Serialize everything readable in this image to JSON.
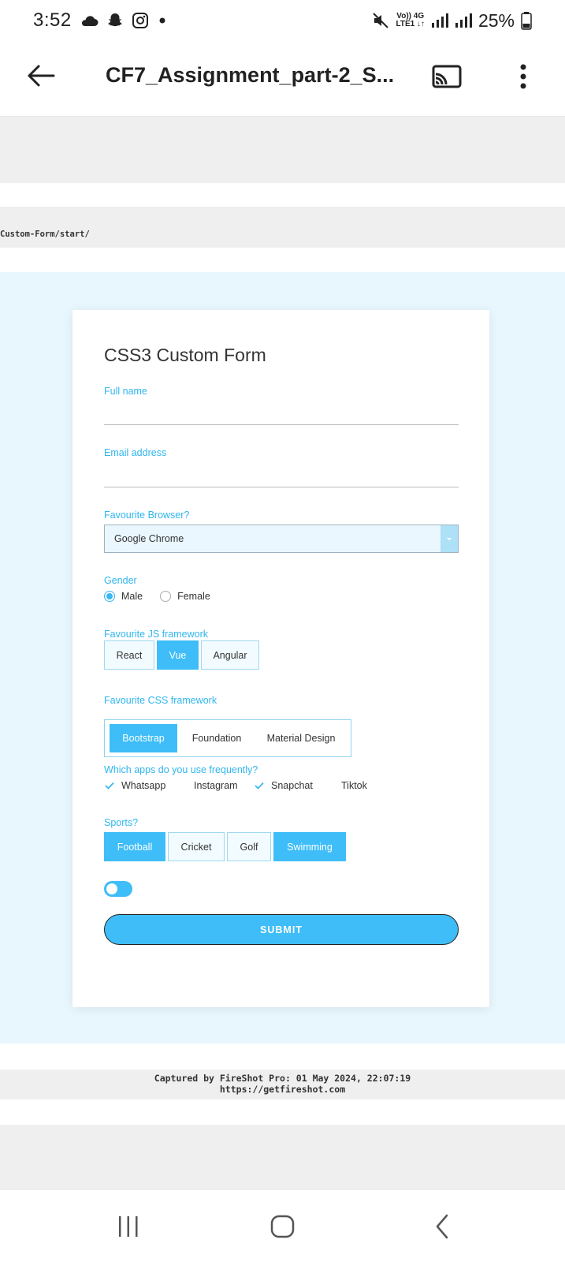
{
  "status_bar": {
    "time": "3:52",
    "net_top": "Vo)) 4G",
    "net_bottom": "LTE1 ↓↑",
    "battery": "25%",
    "icons": [
      "cloud-icon",
      "snapchat-icon",
      "instagram-icon",
      "dot-icon",
      "mute-icon",
      "signal-icon",
      "signal-icon",
      "battery-icon"
    ]
  },
  "app_bar": {
    "title": "CF7_Assignment_part-2_S...",
    "icons": [
      "back-arrow-icon",
      "cast-icon",
      "more-vert-icon"
    ]
  },
  "document": {
    "url_fragment": "Custom-Form/start/",
    "form": {
      "title": "CSS3 Custom Form",
      "full_name_label": "Full name",
      "full_name_value": "",
      "email_label": "Email address",
      "email_value": "",
      "browser_label": "Favourite Browser?",
      "browser_value": "Google Chrome",
      "gender_label": "Gender",
      "gender_options": [
        {
          "label": "Male",
          "selected": true
        },
        {
          "label": "Female",
          "selected": false
        }
      ],
      "js_label": "Favourite JS framework",
      "js_options": [
        {
          "label": "React",
          "selected": false
        },
        {
          "label": "Vue",
          "selected": true
        },
        {
          "label": "Angular",
          "selected": false
        }
      ],
      "css_label": "Favourite CSS framework",
      "css_options": [
        {
          "label": "Bootstrap",
          "selected": true
        },
        {
          "label": "Foundation",
          "selected": false
        },
        {
          "label": "Material Design",
          "selected": false
        }
      ],
      "apps_label": "Which apps do you use frequently?",
      "apps_options": [
        {
          "label": "Whatsapp",
          "checked": true
        },
        {
          "label": "Instagram",
          "checked": false
        },
        {
          "label": "Snapchat",
          "checked": true
        },
        {
          "label": "Tiktok",
          "checked": false
        }
      ],
      "sports_label": "Sports?",
      "sports_options": [
        {
          "label": "Football",
          "selected": true
        },
        {
          "label": "Cricket",
          "selected": false
        },
        {
          "label": "Golf",
          "selected": false
        },
        {
          "label": "Swimming",
          "selected": true
        }
      ],
      "toggle_on": false,
      "submit_label": "SUBMIT"
    },
    "fireshot_line1": "Captured by FireShot Pro: 01 May 2024, 22:07:19",
    "fireshot_line2": "https://getfireshot.com"
  },
  "nav_bar": {
    "icons": [
      "recents-icon",
      "home-icon",
      "back-icon"
    ]
  },
  "colors": {
    "accent": "#3ebdf8",
    "label": "#2fb6ef",
    "page_bg": "#e8f6fe"
  }
}
